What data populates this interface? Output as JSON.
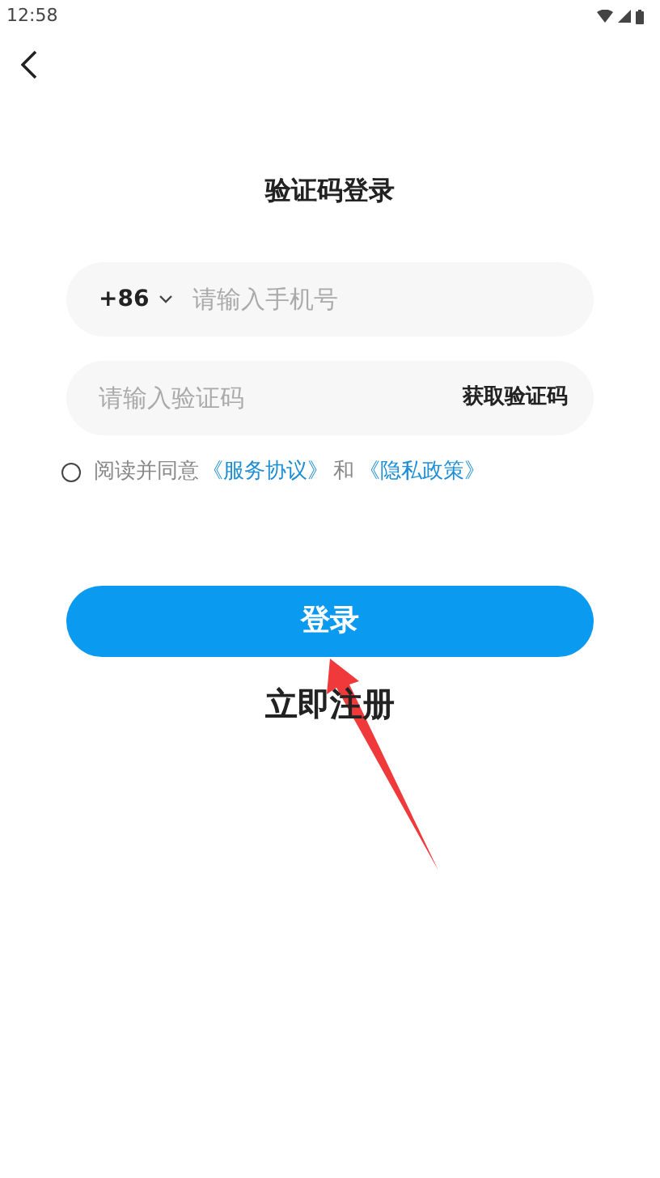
{
  "status_bar": {
    "time": "12:58"
  },
  "title": "验证码登录",
  "phone_field": {
    "country_code": "+86",
    "placeholder": "请输入手机号"
  },
  "code_field": {
    "placeholder": "请输入验证码",
    "action": "获取验证码"
  },
  "agreement": {
    "checked": false,
    "parts": [
      {
        "kind": "text",
        "text": "阅读并同意"
      },
      {
        "kind": "link",
        "text": "《服务协议》"
      },
      {
        "kind": "text",
        "text": "和"
      },
      {
        "kind": "link",
        "text": "《隐私政策》"
      }
    ]
  },
  "login_button": "登录",
  "register_link": "立即注册"
}
